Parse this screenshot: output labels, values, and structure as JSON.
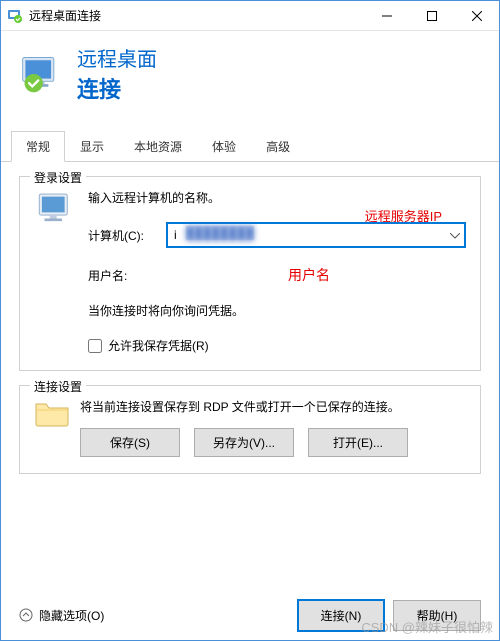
{
  "titlebar": {
    "title": "远程桌面连接"
  },
  "header": {
    "line1": "远程桌面",
    "line2": "连接"
  },
  "tabs": [
    "常规",
    "显示",
    "本地资源",
    "体验",
    "高级"
  ],
  "login": {
    "legend": "登录设置",
    "desc": "输入远程计算机的名称。",
    "computer_label": "计算机(C):",
    "computer_value": "i",
    "computer_annotation": "远程服务器IP",
    "user_label": "用户名:",
    "user_value": "用户名",
    "hint": "当你连接时将向你询问凭据。",
    "checkbox_label": "允许我保存凭据(R)"
  },
  "conn": {
    "legend": "连接设置",
    "desc": "将当前连接设置保存到 RDP 文件或打开一个已保存的连接。",
    "save": "保存(S)",
    "save_as": "另存为(V)...",
    "open": "打开(E)..."
  },
  "footer": {
    "hide_options": "隐藏选项(O)",
    "connect": "连接(N)",
    "help": "帮助(H)"
  },
  "watermark": "CSDN @辣妹子很怕辣"
}
